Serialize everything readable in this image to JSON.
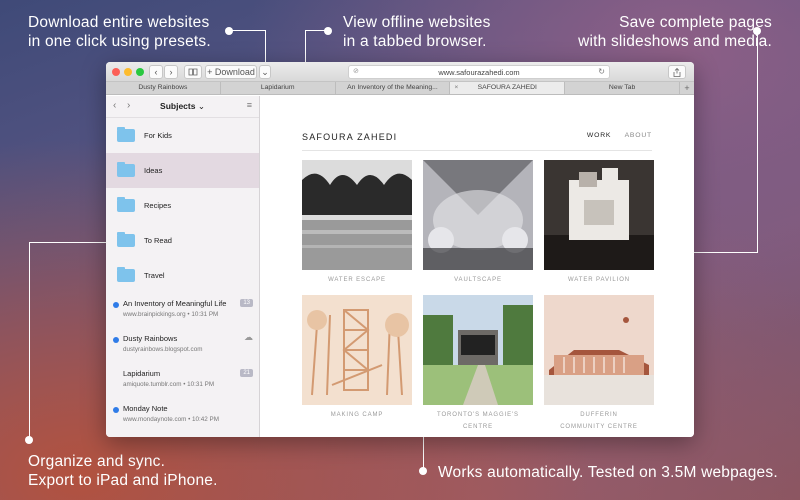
{
  "callouts": {
    "download": [
      "Download entire websites",
      "in one click using presets."
    ],
    "offline": [
      "View offline websites",
      "in a tabbed browser."
    ],
    "save": [
      "Save complete pages",
      "with slideshows and media."
    ],
    "organize": [
      "Organize and sync.",
      "Export to iPad and iPhone."
    ],
    "works": "Works automatically. Tested on 3.5M webpages."
  },
  "toolbar": {
    "download_label": "+ Download",
    "url": "www.safourazahedi.com"
  },
  "tabs": [
    {
      "label": "Dusty Rainbows",
      "active": false
    },
    {
      "label": "Lapidarium",
      "active": false
    },
    {
      "label": "An Inventory of the Meaning...",
      "active": false
    },
    {
      "label": "SAFOURA ZAHEDI",
      "active": true
    },
    {
      "label": "New Tab",
      "active": false
    }
  ],
  "sidebar": {
    "title": "Subjects",
    "folders": [
      {
        "label": "For Kids",
        "selected": false
      },
      {
        "label": "Ideas",
        "selected": true
      },
      {
        "label": "Recipes",
        "selected": false
      },
      {
        "label": "To Read",
        "selected": false
      },
      {
        "label": "Travel",
        "selected": false
      }
    ],
    "sites": [
      {
        "title": "An Inventory of Meaningful Life",
        "url": "www.brainpickings.org • 10:31 PM",
        "unread": true,
        "badge": "13"
      },
      {
        "title": "Dusty Rainbows",
        "url": "dustyrainbows.blogspot.com",
        "unread": true,
        "badge": ""
      },
      {
        "title": "Lapidarium",
        "url": "amiquote.tumblr.com • 10:31 PM",
        "unread": false,
        "badge": "21"
      },
      {
        "title": "Monday Note",
        "url": "www.mondaynote.com • 10:42 PM",
        "unread": true,
        "badge": ""
      }
    ]
  },
  "page": {
    "site_name": "SAFOURA ZAHEDI",
    "nav_work": "WORK",
    "nav_about": "ABOUT",
    "projects": [
      {
        "caption": "WATER ESCAPE",
        "palette": [
          "#2a2a2a",
          "#9a9a9a",
          "#dcdcdc"
        ]
      },
      {
        "caption": "VAULTSCAPE",
        "palette": [
          "#3b3b3f",
          "#b4b4ba",
          "#e6e6ea"
        ]
      },
      {
        "caption": "WATER PAVILION",
        "palette": [
          "#3a3532",
          "#b8b1aa",
          "#ece9e5"
        ]
      },
      {
        "caption": "MAKING CAMP",
        "palette": [
          "#d39a72",
          "#e8c4a4",
          "#f3e0cf"
        ]
      },
      {
        "caption": "TORONTO'S MAGGIE'S CENTRE",
        "palette": [
          "#4f7a3e",
          "#9cc07a",
          "#c9d9e8"
        ]
      },
      {
        "caption": "DUFFERIN COMMUNITY CENTRE",
        "palette": [
          "#a5563d",
          "#d9a085",
          "#eed8cc"
        ]
      }
    ]
  }
}
